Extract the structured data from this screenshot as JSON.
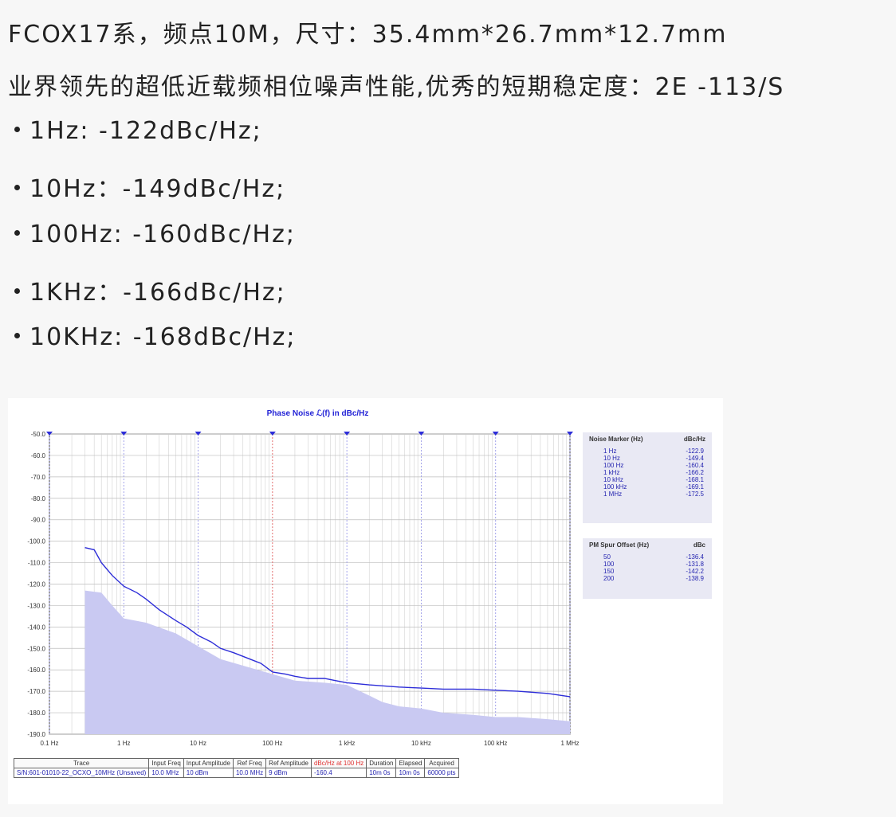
{
  "doc": {
    "line1": "FCOX17系，频点10M，尺寸：35.4mm*26.7mm*12.7mm",
    "line2": "业界领先的超低近载频相位噪声性能,优秀的短期稳定度：2E -113/S",
    "bullets": [
      "1Hz: -122dBc/Hz;",
      "10Hz：-149dBc/Hz;",
      "100Hz: -160dBc/Hz;",
      "1KHz：-166dBc/Hz;",
      "10KHz: -168dBc/Hz;"
    ]
  },
  "chart_data": {
    "type": "line",
    "title": "Phase Noise ℒ(f) in dBc/Hz",
    "x_scale": "log",
    "x_ticks": [
      "0.1 Hz",
      "1 Hz",
      "10 Hz",
      "100 Hz",
      "1 kHz",
      "10 kHz",
      "100 kHz",
      "1 MHz"
    ],
    "y_ticks": [
      "-50.0",
      "-60.0",
      "-70.0",
      "-80.0",
      "-90.0",
      "-100.0",
      "-110.0",
      "-120.0",
      "-130.0",
      "-140.0",
      "-150.0",
      "-160.0",
      "-170.0",
      "-180.0",
      "-190.0"
    ],
    "ylim": [
      -190,
      -50
    ],
    "xlim_hz": [
      0.1,
      1000000
    ],
    "grid": true,
    "reference_line_hz": 100,
    "colors": {
      "trace": "#2d2dd8",
      "fill": "#c9c9f2",
      "ref_line": "#e06060",
      "grid": "#9a9ae8"
    },
    "series": [
      {
        "x": [
          0.3,
          0.4,
          0.5,
          0.7,
          1,
          1.5,
          2,
          3,
          5,
          7,
          10,
          15,
          20,
          30,
          50,
          70,
          100,
          150,
          200,
          300,
          500,
          700,
          1000,
          2000,
          5000,
          10000,
          20000,
          50000,
          100000,
          200000,
          500000,
          1000000
        ],
        "y": [
          -103,
          -104,
          -110,
          -116,
          -121,
          -124,
          -127,
          -132,
          -137,
          -140,
          -144,
          -147,
          -150,
          -152,
          -155,
          -157,
          -161,
          -162,
          -163,
          -164,
          -164,
          -165,
          -166,
          -167,
          -168,
          -168.5,
          -169,
          -169,
          -169.5,
          -170,
          -171,
          -172.5
        ]
      },
      {
        "x": [
          0.3,
          0.5,
          0.7,
          1,
          2,
          5,
          10,
          20,
          50,
          100,
          200,
          500,
          1000,
          2000,
          3000,
          5000,
          10000,
          20000,
          50000,
          100000,
          200000,
          500000,
          1000000
        ],
        "y": [
          -123,
          -124,
          -130,
          -136,
          -138,
          -143,
          -149,
          -155,
          -159,
          -162,
          -165,
          -166,
          -167,
          -172,
          -175,
          -177,
          -178,
          -180,
          -181,
          -182,
          -182,
          -183,
          -184
        ]
      }
    ]
  },
  "noise_marker": {
    "header": [
      "Noise Marker (Hz)",
      "dBc/Hz"
    ],
    "rows": [
      [
        "1 Hz",
        "-122.9"
      ],
      [
        "10 Hz",
        "-149.4"
      ],
      [
        "100 Hz",
        "-160.4"
      ],
      [
        "1 kHz",
        "-166.2"
      ],
      [
        "10 kHz",
        "-168.1"
      ],
      [
        "100 kHz",
        "-169.1"
      ],
      [
        "1 MHz",
        "-172.5"
      ]
    ]
  },
  "pm_spur": {
    "header": [
      "PM Spur Offset (Hz)",
      "dBc"
    ],
    "rows": [
      [
        "50",
        "-136.4"
      ],
      [
        "100",
        "-131.8"
      ],
      [
        "150",
        "-142.2"
      ],
      [
        "200",
        "-138.9"
      ]
    ]
  },
  "spec_table": {
    "headers": [
      "Trace",
      "Input Freq",
      "Input Amplitude",
      "Ref Freq",
      "Ref Amplitude",
      "dBc/Hz at 100 Hz",
      "Duration",
      "Elapsed",
      "Acquired"
    ],
    "row": [
      "S/N:601-01010-22_OCXO_10MHz (Unsaved)",
      "10.0 MHz",
      "10 dBm",
      "10.0 MHz",
      "9 dBm",
      "-160.4",
      "10m 0s",
      "10m 0s",
      "60000 pts"
    ]
  }
}
